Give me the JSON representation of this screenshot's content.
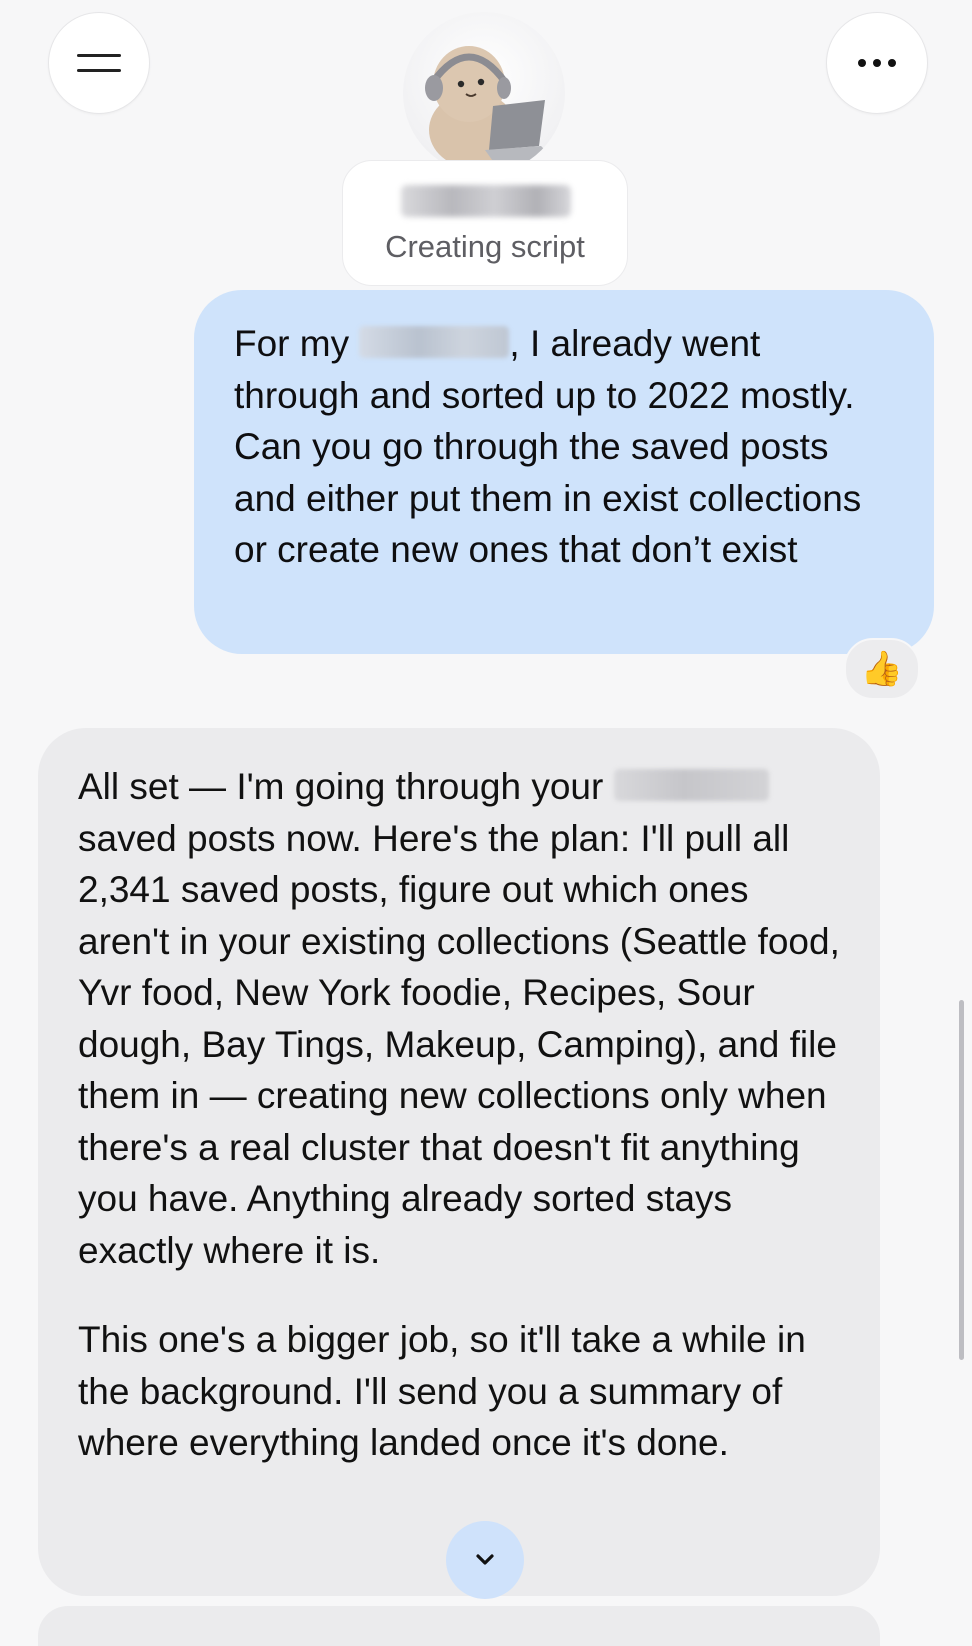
{
  "header": {
    "menu_icon": "hamburger-icon",
    "more_icon": "more-horizontal-icon",
    "avatar": "headphones-laptop-mascot",
    "status_text": "Creating script"
  },
  "messages": {
    "user": {
      "text_before_redaction": "For my ",
      "text_after_redaction": ", I already went through and sorted up to 2022 mostly. Can you go through the saved posts and either put them in exist collections or create new ones that don’t exist",
      "reaction": "👍"
    },
    "assistant": {
      "p1_before_redaction": "All set — I'm going through your ",
      "p1_after_redaction": " saved posts now. Here's the plan: I'll pull all 2,341 saved posts, figure out which ones aren't in your existing collections (Seattle food, Yvr food, New York foodie, Recipes, Sour dough, Bay Tings, Makeup, Camping), and file them in — creating new collections only when there's a real cluster that doesn't fit anything you have. Anything already sorted stays exactly where it is.",
      "p2": "This one's a bigger job, so it'll take a while in the background. I'll send you a summary of where everything landed once it's done."
    }
  },
  "controls": {
    "scroll_down_icon": "chevron-down-icon"
  },
  "colors": {
    "user_bubble": "#cfe3fb",
    "assistant_bubble": "#ebebed",
    "background": "#f7f7f8"
  }
}
